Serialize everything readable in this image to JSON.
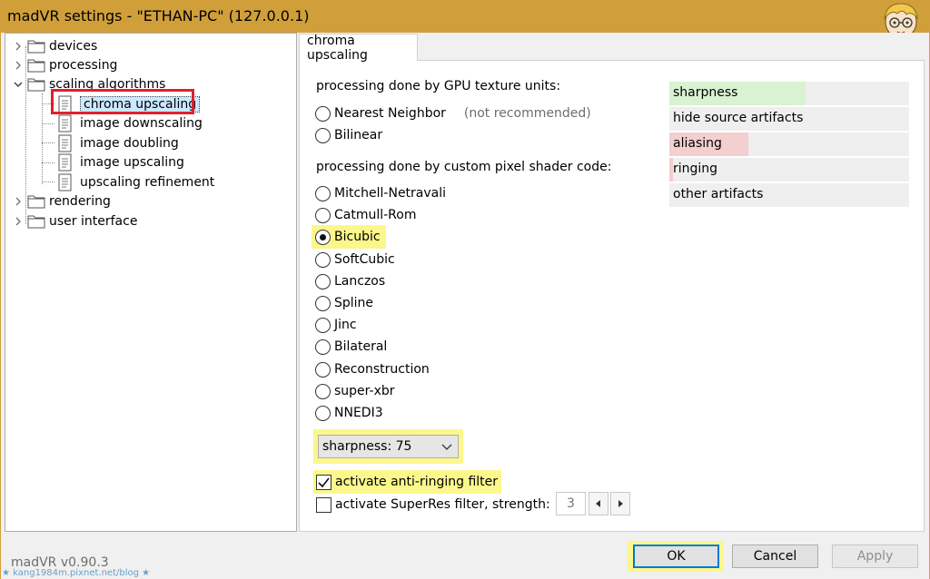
{
  "window": {
    "title": "madVR settings - \"ETHAN-PC\" (127.0.0.1)"
  },
  "tree": {
    "items": [
      {
        "label": "devices"
      },
      {
        "label": "processing"
      },
      {
        "label": "scaling algorithms"
      },
      {
        "label": "chroma upscaling"
      },
      {
        "label": "image downscaling"
      },
      {
        "label": "image doubling"
      },
      {
        "label": "image upscaling"
      },
      {
        "label": "upscaling refinement"
      },
      {
        "label": "rendering"
      },
      {
        "label": "user interface"
      }
    ],
    "selected": "chroma upscaling"
  },
  "tab": {
    "label": "chroma upscaling"
  },
  "gpu_group": {
    "label": "processing done by GPU texture units:",
    "options": [
      {
        "label": "Nearest Neighbor",
        "note": "(not recommended)"
      },
      {
        "label": "Bilinear"
      }
    ]
  },
  "shader_group": {
    "label": "processing done by custom pixel shader code:",
    "options": [
      {
        "label": "Mitchell-Netravali"
      },
      {
        "label": "Catmull-Rom"
      },
      {
        "label": "Bicubic",
        "checked": true
      },
      {
        "label": "SoftCubic"
      },
      {
        "label": "Lanczos"
      },
      {
        "label": "Spline"
      },
      {
        "label": "Jinc"
      },
      {
        "label": "Bilateral"
      },
      {
        "label": "Reconstruction"
      },
      {
        "label": "super-xbr"
      },
      {
        "label": "NNEDI3"
      }
    ]
  },
  "sharpness_select": {
    "value": "sharpness: 75"
  },
  "anti_ringing": {
    "label": "activate anti-ringing filter",
    "checked": true
  },
  "superres": {
    "label": "activate SuperRes filter, strength:",
    "checked": false,
    "strength": "3"
  },
  "legend": {
    "items": [
      {
        "label": "sharpness",
        "fill": 0.57,
        "color": "#d8f2d2"
      },
      {
        "label": "hide source artifacts",
        "fill": 0.0,
        "color": "#efefef"
      },
      {
        "label": "aliasing",
        "fill": 0.33,
        "color": "#f3cfcf"
      },
      {
        "label": "ringing",
        "fill": 0.0,
        "color": "#f3cfcf"
      },
      {
        "label": "other artifacts",
        "fill": 0.0,
        "color": "#efefef"
      }
    ]
  },
  "footer": {
    "version": "madVR v0.90.3",
    "watermark": "★ kang1984m.pixnet.net/blog ★",
    "ok": "OK",
    "cancel": "Cancel",
    "apply": "Apply"
  },
  "colors": {
    "titlebar": "#d19f3a",
    "highlight": "#fbf78c",
    "annotation_red": "#e0202c",
    "default_button_border": "#0078d7"
  }
}
